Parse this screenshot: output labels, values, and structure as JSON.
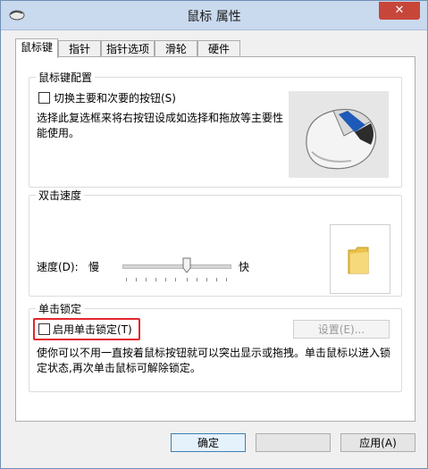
{
  "window": {
    "title": "鼠标 属性",
    "close_symbol": "✕"
  },
  "tabs": [
    {
      "label": "鼠标键",
      "active": true
    },
    {
      "label": "指针",
      "active": false
    },
    {
      "label": "指针选项",
      "active": false
    },
    {
      "label": "滑轮",
      "active": false
    },
    {
      "label": "硬件",
      "active": false
    }
  ],
  "button_config": {
    "group_label": "鼠标键配置",
    "switch_checkbox_label": "切换主要和次要的按钮(S)",
    "switch_checked": false,
    "description": "选择此复选框来将右按钮设成如选择和拖放等主要性能使用。",
    "icon": "mouse-illustration"
  },
  "double_click": {
    "group_label": "双击速度",
    "speed_label": "速度(D):",
    "slow_label": "慢",
    "fast_label": "快",
    "slider_level": 0.5,
    "icon": "folder-test-icon"
  },
  "click_lock": {
    "group_label": "单击锁定",
    "checkbox_label": "启用单击锁定(T)",
    "checked": false,
    "settings_button": "设置(E)...",
    "description": "使你可以不用一直按着鼠标按钮就可以突出显示或拖拽。单击鼠标以进入锁定状态,再次单击鼠标可解除锁定。",
    "highlight_color": "#e3262d"
  },
  "footer": {
    "ok_button": "确定",
    "cancel_button": "",
    "apply_button": "应用(A)"
  }
}
